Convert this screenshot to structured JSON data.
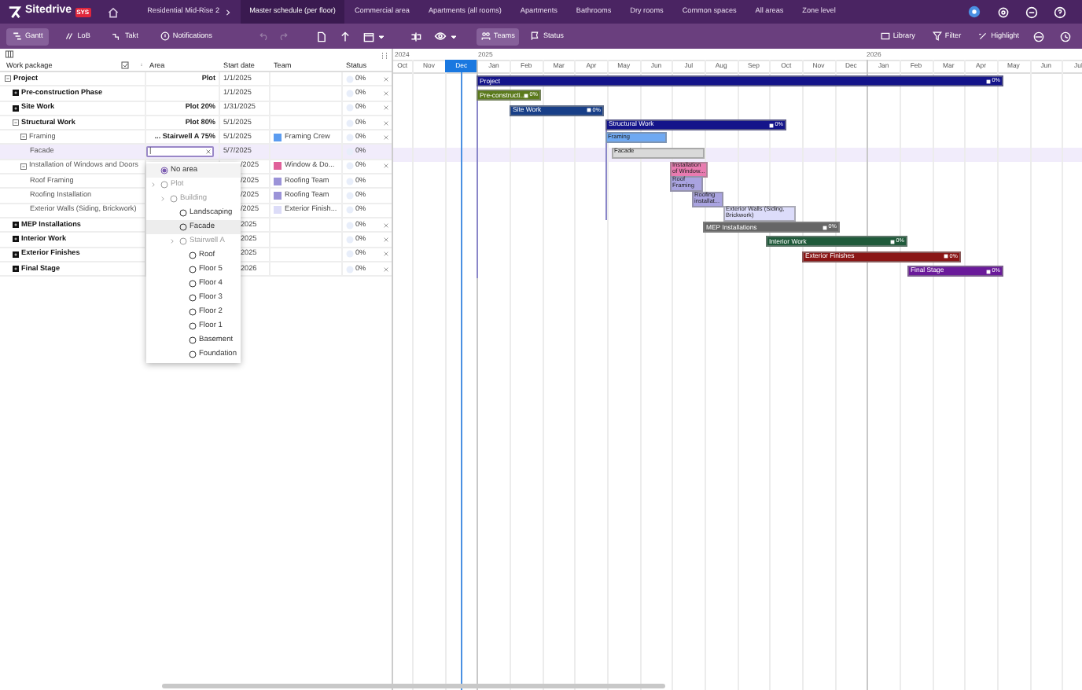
{
  "app": {
    "logo": "Sitedrive",
    "badge": "SYS"
  },
  "nav_tabs": [
    {
      "label": "Residential Mid-Rise 2",
      "selected": false,
      "chevron": true
    },
    {
      "label": "Master schedule (per floor)",
      "selected": true,
      "chevron": false
    },
    {
      "label": "Commercial area",
      "selected": false,
      "chevron": false
    },
    {
      "label": "Apartments (all rooms)",
      "selected": false,
      "chevron": false
    },
    {
      "label": "Apartments",
      "selected": false,
      "chevron": false
    },
    {
      "label": "Bathrooms",
      "selected": false,
      "chevron": false
    },
    {
      "label": "Dry rooms",
      "selected": false,
      "chevron": false
    },
    {
      "label": "Common spaces",
      "selected": false,
      "chevron": false
    },
    {
      "label": "All areas",
      "selected": false,
      "chevron": false
    },
    {
      "label": "Zone level",
      "selected": false,
      "chevron": false
    }
  ],
  "view_tabs": [
    {
      "label": "Gantt",
      "selected": true
    },
    {
      "label": "LoB",
      "selected": false
    },
    {
      "label": "Takt",
      "selected": false
    },
    {
      "label": "Notifications",
      "selected": false
    }
  ],
  "color_by": [
    {
      "label": "Teams",
      "selected": true
    },
    {
      "label": "Status",
      "selected": false
    }
  ],
  "right_tools": [
    "Library",
    "Filter",
    "Highlight"
  ],
  "table": {
    "columns": [
      "Work package",
      "Area",
      "Start date",
      "Team",
      "Status"
    ],
    "rows": [
      {
        "name": "Project",
        "expanded": true,
        "area": "Plot",
        "start": "1/1/2025",
        "status": "0%",
        "removable": true,
        "selected": false,
        "bar": {
          "label": "Project",
          "color": "#14148a",
          "progress": "0%"
        }
      },
      {
        "name": "Pre-construction Phase",
        "expanded": false,
        "area": "",
        "start": "1/1/2025",
        "status": "0%",
        "removable": true,
        "selected": false,
        "bar": {
          "label": "Pre-constructi...",
          "color": "#5b7a1c",
          "progress": "0%"
        }
      },
      {
        "name": "Site Work",
        "expanded": false,
        "area": "Plot 20%",
        "start": "1/31/2025",
        "status": "0%",
        "removable": true,
        "selected": false,
        "bar": {
          "label": "Site Work",
          "color": "#183f88",
          "progress": "0%"
        }
      },
      {
        "name": "Structural Work",
        "expanded": true,
        "area": "Plot 80%",
        "start": "5/1/2025",
        "status": "0%",
        "removable": true,
        "selected": false,
        "bar": {
          "label": "Structural Work",
          "color": "#14148a",
          "progress": "0%"
        }
      },
      {
        "name": "Framing",
        "expanded": true,
        "area": "... Stairwell A 75%",
        "start": "5/1/2025",
        "team": {
          "name": "Framing Crew",
          "color": "#5b9cf0"
        },
        "status": "0%",
        "removable": true,
        "selected": false,
        "bar": {
          "label": "Framing",
          "color": "#6fa9f2"
        }
      },
      {
        "name": "Facade",
        "start": "5/7/2025",
        "status": "0%",
        "removable": false,
        "selected": true,
        "bar": {
          "label": "Facade",
          "color": "#d9d9d9"
        }
      },
      {
        "name": "Installation of Windows and Doors",
        "expanded": true,
        "start": "/2025",
        "team": {
          "name": "Window & Do...",
          "color": "#e0609a"
        },
        "status": "0%",
        "removable": true,
        "selected": false,
        "bar": {
          "label": "Installation of Window...",
          "color": "#e87bb0"
        }
      },
      {
        "name": "Roof Framing",
        "start": "/2025",
        "team": {
          "name": "Roofing Team",
          "color": "#9b93d8"
        },
        "status": "0%",
        "removable": false,
        "selected": false,
        "bar": {
          "label": "Roof Framing",
          "color": "#a9a3e0"
        }
      },
      {
        "name": "Roofing Installation",
        "start": "/2025",
        "team": {
          "name": "Roofing Team",
          "color": "#9b93d8"
        },
        "status": "0%",
        "removable": false,
        "selected": false,
        "bar": {
          "label": "Roofing installat...",
          "color": "#a9a3e0"
        }
      },
      {
        "name": "Exterior Walls (Siding, Brickwork)",
        "start": "/2025",
        "team": {
          "name": "Exterior Finish...",
          "color": "#dcdcf8"
        },
        "status": "0%",
        "removable": false,
        "selected": false,
        "bar": {
          "label": "Exterior Walls (Siding, Brickwork)",
          "color": "#dcdcfa"
        }
      },
      {
        "name": "MEP Installations",
        "expanded": false,
        "start": "2025",
        "status": "0%",
        "removable": true,
        "selected": false,
        "bar": {
          "label": "MEP Installations",
          "color": "#666666",
          "progress": "0%"
        }
      },
      {
        "name": "Interior Work",
        "expanded": false,
        "start": "2025",
        "status": "0%",
        "removable": true,
        "selected": false,
        "bar": {
          "label": "Interior Work",
          "color": "#1f5a3a",
          "progress": "0%"
        }
      },
      {
        "name": "Exterior Finishes",
        "expanded": false,
        "start": "2025",
        "status": "0%",
        "removable": true,
        "selected": false,
        "bar": {
          "label": "Exterior Finishes",
          "color": "#8a1616",
          "progress": "0%"
        }
      },
      {
        "name": "Final Stage",
        "expanded": false,
        "start": "2026",
        "status": "0%",
        "removable": true,
        "selected": false,
        "bar": {
          "label": "Final Stage",
          "color": "#6a1a9a",
          "progress": "0%"
        }
      }
    ]
  },
  "area_dropdown": {
    "value": "|",
    "options": [
      {
        "label": "No area",
        "selected": true,
        "disabled": false,
        "highlighted": false
      },
      {
        "label": "Plot",
        "selected": false,
        "disabled": true,
        "highlighted": false,
        "children": [
          {
            "label": "Building",
            "selected": false,
            "disabled": true,
            "highlighted": false,
            "children": [
              {
                "label": "Landscaping",
                "selected": false,
                "disabled": false,
                "highlighted": false
              },
              {
                "label": "Facade",
                "selected": false,
                "disabled": false,
                "highlighted": true
              },
              {
                "label": "Stairwell A",
                "selected": false,
                "disabled": true,
                "highlighted": false,
                "children": [
                  {
                    "label": "Roof",
                    "selected": false,
                    "disabled": false,
                    "highlighted": false
                  },
                  {
                    "label": "Floor 5",
                    "selected": false,
                    "disabled": false,
                    "highlighted": false
                  },
                  {
                    "label": "Floor 4",
                    "selected": false,
                    "disabled": false,
                    "highlighted": false
                  },
                  {
                    "label": "Floor 3",
                    "selected": false,
                    "disabled": false,
                    "highlighted": false
                  },
                  {
                    "label": "Floor 2",
                    "selected": false,
                    "disabled": false,
                    "highlighted": false
                  },
                  {
                    "label": "Floor 1",
                    "selected": false,
                    "disabled": false,
                    "highlighted": false
                  },
                  {
                    "label": "Basement",
                    "selected": false,
                    "disabled": false,
                    "highlighted": false
                  },
                  {
                    "label": "Foundation",
                    "selected": false,
                    "disabled": false,
                    "highlighted": false
                  }
                ]
              }
            ]
          }
        ]
      }
    ]
  },
  "timeline": {
    "years": [
      "2024",
      "2025",
      "2026"
    ],
    "months": [
      {
        "label": "Oct",
        "selected": false
      },
      {
        "label": "Nov",
        "selected": false
      },
      {
        "label": "Dec",
        "selected": true
      },
      {
        "label": "Jan",
        "selected": false
      },
      {
        "label": "Feb",
        "selected": false
      },
      {
        "label": "Mar",
        "selected": false
      },
      {
        "label": "Apr",
        "selected": false
      },
      {
        "label": "May",
        "selected": false
      },
      {
        "label": "Jun",
        "selected": false
      },
      {
        "label": "Jul",
        "selected": false
      },
      {
        "label": "Aug",
        "selected": false
      },
      {
        "label": "Sep",
        "selected": false
      },
      {
        "label": "Oct",
        "selected": false
      },
      {
        "label": "Nov",
        "selected": false
      },
      {
        "label": "Dec",
        "selected": false
      },
      {
        "label": "Jan",
        "selected": false
      },
      {
        "label": "Feb",
        "selected": false
      },
      {
        "label": "Mar",
        "selected": false
      },
      {
        "label": "Apr",
        "selected": false
      },
      {
        "label": "May",
        "selected": false
      },
      {
        "label": "Jun",
        "selected": false
      },
      {
        "label": "Jul",
        "selected": false
      }
    ]
  }
}
